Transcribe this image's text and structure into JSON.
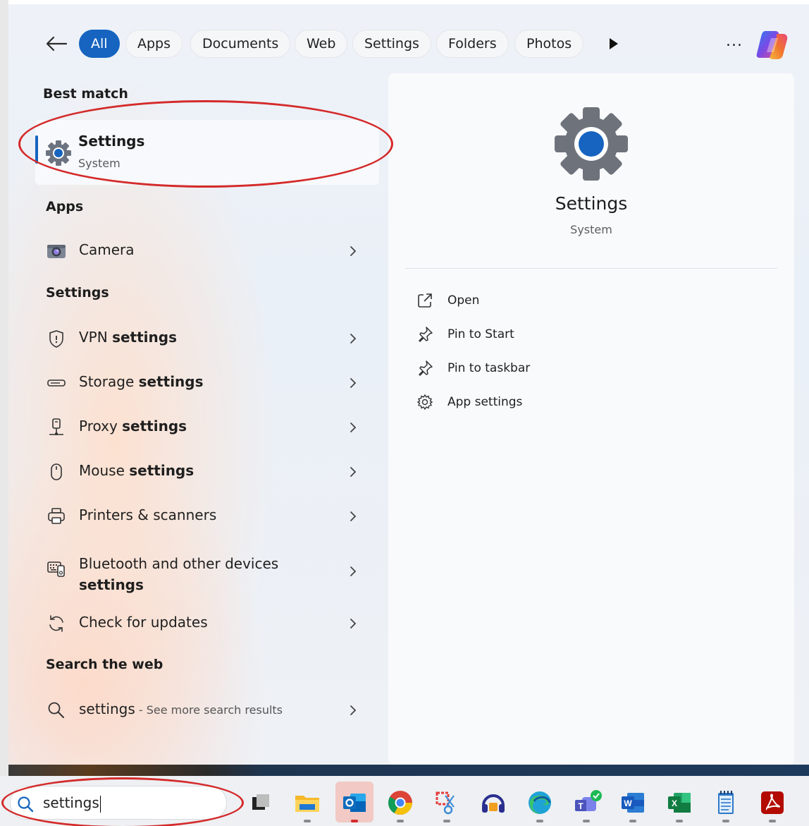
{
  "filters": {
    "back_label": "Back",
    "chips": [
      "All",
      "Apps",
      "Documents",
      "Web",
      "Settings",
      "Folders",
      "Photos"
    ],
    "more_label": "...",
    "copilot_name": "copilot-icon"
  },
  "best_match": {
    "heading": "Best match",
    "title": "Settings",
    "subtitle": "System"
  },
  "apps": {
    "heading": "Apps",
    "items": [
      {
        "label": "Camera",
        "icon": "camera-icon"
      }
    ]
  },
  "settings_section": {
    "heading": "Settings",
    "items": [
      {
        "pre": "VPN ",
        "bold": "settings",
        "icon": "shield-icon"
      },
      {
        "pre": "Storage ",
        "bold": "settings",
        "icon": "storage-icon"
      },
      {
        "pre": "Proxy ",
        "bold": "settings",
        "icon": "proxy-icon"
      },
      {
        "pre": "Mouse ",
        "bold": "settings",
        "icon": "mouse-icon"
      },
      {
        "pre": "Printers & scanners",
        "bold": "",
        "icon": "printer-icon"
      },
      {
        "pre": "Bluetooth and other devices",
        "bold": "settings",
        "icon": "devices-icon"
      },
      {
        "pre": "Check for updates",
        "bold": "",
        "icon": "refresh-icon"
      }
    ]
  },
  "web": {
    "heading": "Search the web",
    "query": "settings",
    "suffix": " - See more search results"
  },
  "preview": {
    "title": "Settings",
    "subtitle": "System",
    "actions": [
      {
        "label": "Open",
        "icon": "open-external-icon"
      },
      {
        "label": "Pin to Start",
        "icon": "pin-icon"
      },
      {
        "label": "Pin to taskbar",
        "icon": "pin-icon"
      },
      {
        "label": "App settings",
        "icon": "gear-icon"
      }
    ]
  },
  "taskbar": {
    "search_text": "settings",
    "apps": [
      "task-view",
      "file-explorer",
      "outlook",
      "chrome",
      "snipping-tool",
      "audio-app",
      "edge",
      "teams",
      "word",
      "excel",
      "notepad",
      "acrobat"
    ]
  },
  "colors": {
    "accent": "#1664c0",
    "annotation": "#d42a2a"
  }
}
